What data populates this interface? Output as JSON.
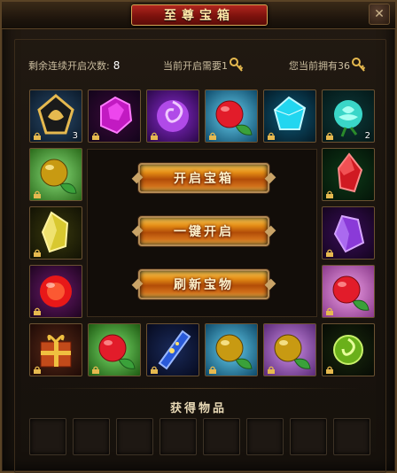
{
  "window": {
    "title": "至尊宝箱"
  },
  "info": {
    "remaining_label": "剩余连续开启次数:",
    "remaining_value": "8",
    "need_label": "当前开启需要1",
    "own_label": "您当前拥有36"
  },
  "slots": [
    {
      "name": "golden-dragon-token",
      "count": "3"
    },
    {
      "name": "purple-crystal-ore",
      "count": ""
    },
    {
      "name": "purple-swirl-orb",
      "count": ""
    },
    {
      "name": "red-fruit-orb",
      "count": ""
    },
    {
      "name": "cyan-diamond",
      "count": ""
    },
    {
      "name": "cyan-rose",
      "count": "2"
    },
    {
      "name": "golden-fruit-orb",
      "count": ""
    },
    {
      "name": "red-gem-crystal",
      "count": ""
    },
    {
      "name": "yellow-crystal",
      "count": ""
    },
    {
      "name": "purple-crystal",
      "count": ""
    },
    {
      "name": "red-glow-orb",
      "count": ""
    },
    {
      "name": "red-fruit-orb-pink",
      "count": ""
    },
    {
      "name": "gift-box",
      "count": ""
    },
    {
      "name": "red-fruit-orb-green",
      "count": ""
    },
    {
      "name": "blue-scroll",
      "count": ""
    },
    {
      "name": "golden-fruit-orb-cyan",
      "count": ""
    },
    {
      "name": "golden-fruit-orb-purple",
      "count": ""
    },
    {
      "name": "green-swirl-orb",
      "count": ""
    }
  ],
  "buttons": {
    "open": "开启宝箱",
    "one_key": "一键开启",
    "refresh": "刷新宝物"
  },
  "obtained": {
    "title": "获得物品",
    "slot_count": 8
  },
  "colors": {
    "accent_gold": "#d6a453",
    "title_red": "#b1261e",
    "button_orange": "#e28a14"
  }
}
